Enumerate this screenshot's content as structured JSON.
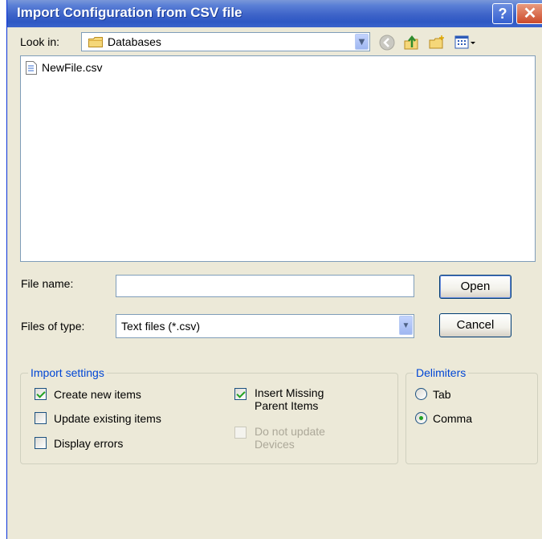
{
  "window": {
    "title": "Import Configuration from CSV file"
  },
  "titlebar": {
    "help_label": "?",
    "close_label": "✕"
  },
  "lookin": {
    "label": "Look in:",
    "value": "Databases"
  },
  "toolbar": {
    "icons": [
      "back-icon",
      "up-folder-icon",
      "new-folder-icon",
      "view-menu-icon"
    ]
  },
  "files": [
    {
      "name": "NewFile.csv",
      "icon": "csv-file-icon"
    }
  ],
  "filename": {
    "label": "File name:",
    "value": ""
  },
  "filetype": {
    "label": "Files of type:",
    "value": "Text files (*.csv)"
  },
  "buttons": {
    "open": "Open",
    "cancel": "Cancel"
  },
  "import_settings": {
    "title": "Import settings",
    "options": {
      "create_new": {
        "label": "Create new items",
        "checked": true
      },
      "update_existing": {
        "label": "Update existing items",
        "checked": false
      },
      "display_errors": {
        "label": "Display errors",
        "checked": false
      },
      "insert_missing": {
        "label_line1": "Insert Missing",
        "label_line2": "Parent Items",
        "checked": true
      },
      "do_not_update": {
        "label_line1": "Do not update",
        "label_line2": "Devices",
        "checked": false,
        "enabled": false
      }
    }
  },
  "delimiters": {
    "title": "Delimiters",
    "tab": {
      "label": "Tab",
      "selected": false
    },
    "comma": {
      "label": "Comma",
      "selected": true
    }
  }
}
